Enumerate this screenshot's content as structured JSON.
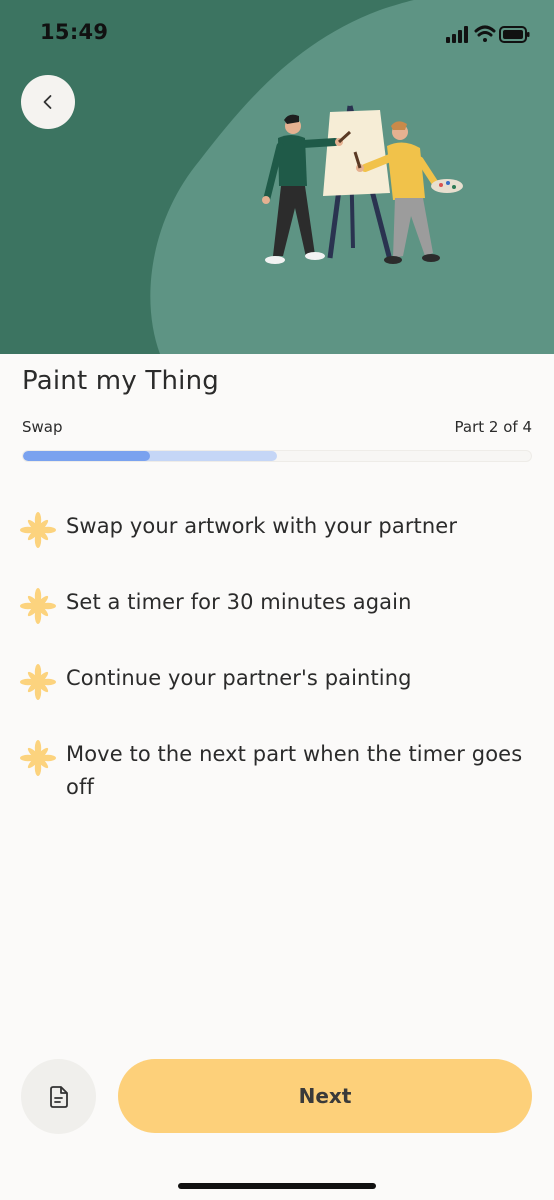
{
  "status": {
    "time": "15:49"
  },
  "activity": {
    "title": "Paint my Thing",
    "step_name": "Swap",
    "part_label": "Part 2 of 4",
    "progress": {
      "current": 2,
      "total": 4,
      "filled_fraction": 0.25,
      "buffered_fraction": 0.5
    }
  },
  "steps": [
    {
      "text": "Swap your artwork with your partner"
    },
    {
      "text": "Set a timer for 30 minutes again"
    },
    {
      "text": "Continue your partner's painting"
    },
    {
      "text": "Move to the next part when the timer goes off"
    }
  ],
  "footer": {
    "next_label": "Next"
  },
  "icons": {
    "back": "chevron-left-icon",
    "step_bullet": "flower-icon",
    "notes": "document-icon"
  },
  "colors": {
    "hero_bg": "#3c7461",
    "hero_blob": "#5e9484",
    "accent_yellow": "#fdd07a",
    "progress_primary": "#7aa2ef",
    "progress_secondary": "#c5d6f6",
    "bullet": "#fcd37e"
  }
}
